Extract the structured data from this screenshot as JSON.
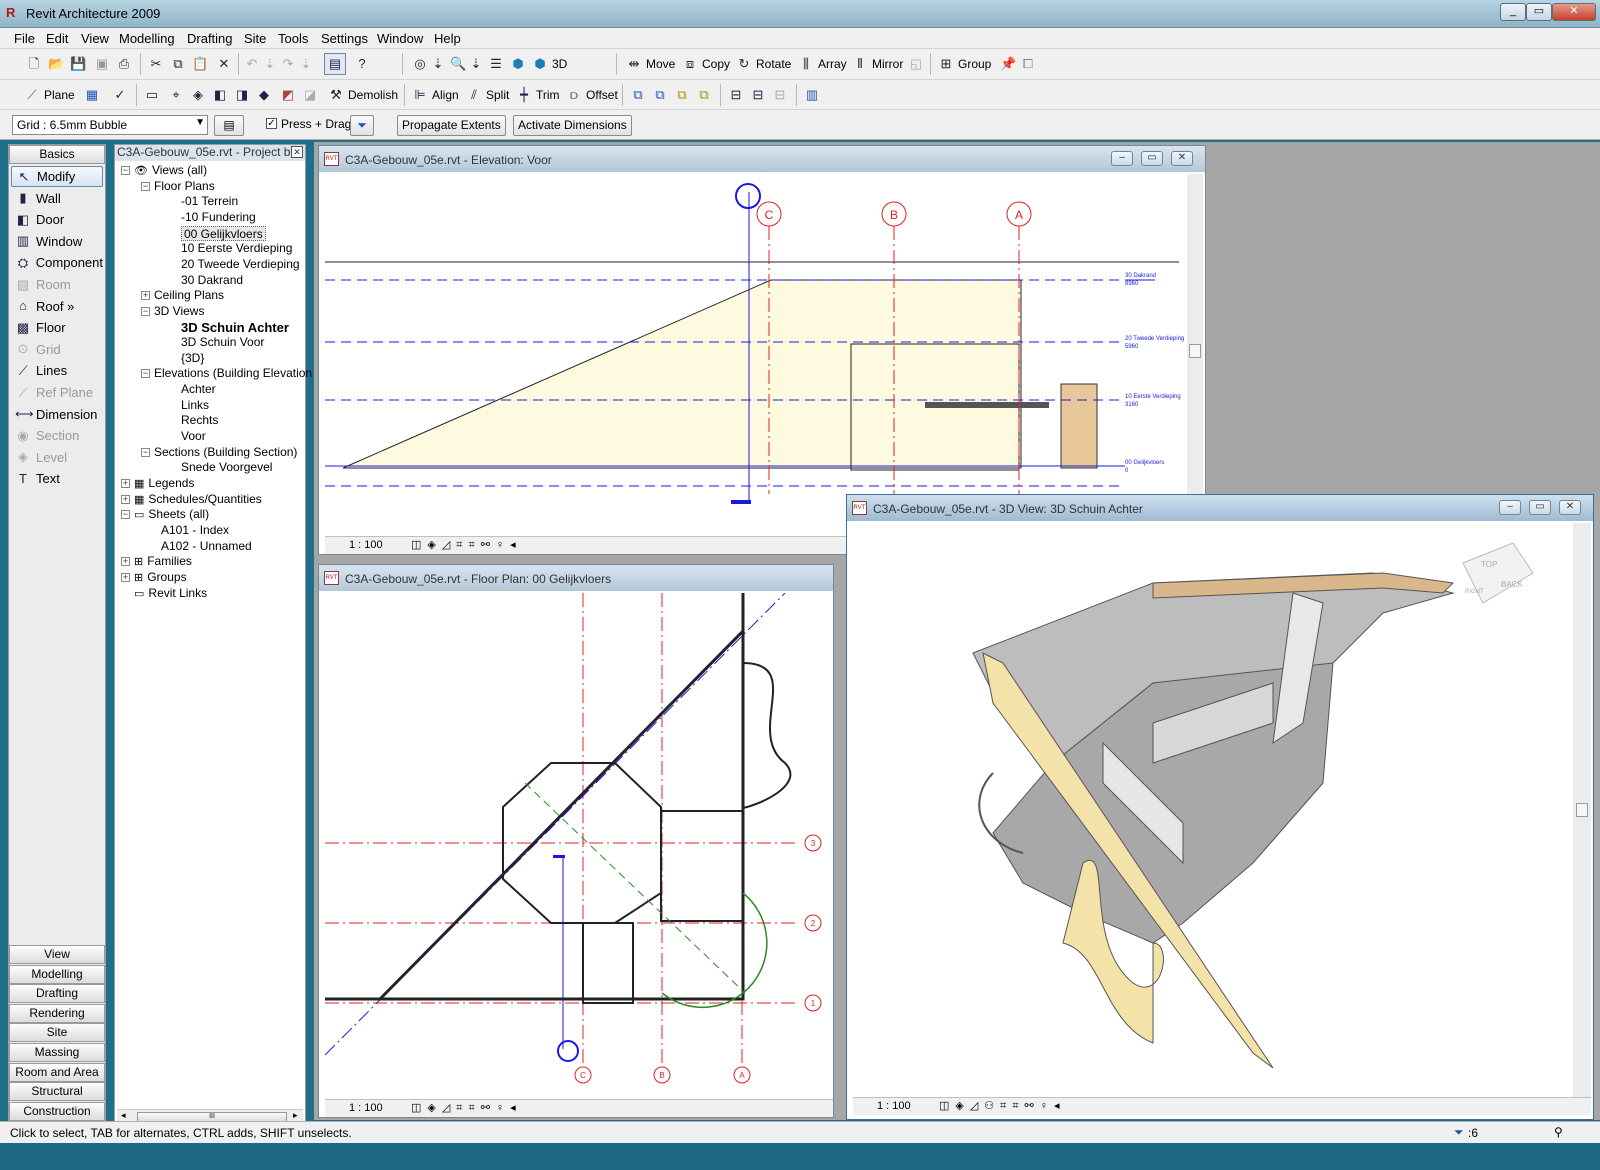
{
  "app": {
    "title": "Revit Architecture 2009"
  },
  "menu": [
    "File",
    "Edit",
    "View",
    "Modelling",
    "Drafting",
    "Site",
    "Tools",
    "Settings",
    "Window",
    "Help"
  ],
  "toolbar1": {
    "view3d": "3D",
    "move": "Move",
    "copy": "Copy",
    "rotate": "Rotate",
    "array": "Array",
    "mirror": "Mirror",
    "group": "Group"
  },
  "toolbar2": {
    "plane": "Plane",
    "demolish": "Demolish",
    "align": "Align",
    "split": "Split",
    "trim": "Trim",
    "offset": "Offset"
  },
  "options": {
    "type_selector": "Grid : 6.5mm Bubble",
    "press_drag": "Press + Drag",
    "propagate": "Propagate Extents",
    "activate_dims": "Activate Dimensions"
  },
  "designbar": {
    "active_tab": "Basics",
    "items": [
      {
        "label": "Modify",
        "icon": "cursor-icon",
        "enabled": true
      },
      {
        "label": "Wall",
        "icon": "wall-icon",
        "enabled": true
      },
      {
        "label": "Door",
        "icon": "door-icon",
        "enabled": true
      },
      {
        "label": "Window",
        "icon": "window-icon",
        "enabled": true
      },
      {
        "label": "Component",
        "icon": "component-icon",
        "enabled": true
      },
      {
        "label": "Room",
        "icon": "room-icon",
        "enabled": false
      },
      {
        "label": "Roof »",
        "icon": "roof-icon",
        "enabled": true
      },
      {
        "label": "Floor",
        "icon": "floor-icon",
        "enabled": true
      },
      {
        "label": "Grid",
        "icon": "grid-icon",
        "enabled": false
      },
      {
        "label": "Lines",
        "icon": "lines-icon",
        "enabled": true
      },
      {
        "label": "Ref Plane",
        "icon": "ref-plane-icon",
        "enabled": false
      },
      {
        "label": "Dimension",
        "icon": "dimension-icon",
        "enabled": true
      },
      {
        "label": "Section",
        "icon": "section-icon",
        "enabled": false
      },
      {
        "label": "Level",
        "icon": "level-icon",
        "enabled": false
      },
      {
        "label": "Text",
        "icon": "text-icon",
        "enabled": true
      }
    ],
    "tabs": [
      "View",
      "Modelling",
      "Drafting",
      "Rendering",
      "Site",
      "Massing",
      "Room and Area",
      "Structural",
      "Construction"
    ]
  },
  "browser": {
    "title": "C3A-Gebouw_05e.rvt - Project b...",
    "root": "Views (all)",
    "floor_plans": "Floor Plans",
    "floor_plan_items": [
      "-01 Terrein",
      "-10 Fundering",
      "00 Gelijkvloers",
      "10 Eerste Verdieping",
      "20 Tweede Verdieping",
      "30 Dakrand"
    ],
    "ceiling_plans": "Ceiling Plans",
    "views3d": "3D Views",
    "views3d_items": [
      "3D Schuin Achter",
      "3D Schuin Voor",
      "{3D}"
    ],
    "elevations": "Elevations (Building Elevation",
    "elevation_items": [
      "Achter",
      "Links",
      "Rechts",
      "Voor"
    ],
    "sections": "Sections (Building Section)",
    "section_items": [
      "Snede Voorgevel"
    ],
    "legends": "Legends",
    "schedules": "Schedules/Quantities",
    "sheets": "Sheets (all)",
    "sheet_items": [
      "A101 - Index",
      "A102 - Unnamed"
    ],
    "families": "Families",
    "groups": "Groups",
    "links": "Revit Links"
  },
  "views": {
    "elevation": {
      "title": "C3A-Gebouw_05e.rvt - Elevation: Voor",
      "scale": "1 : 100",
      "grids": [
        "C",
        "B",
        "A"
      ],
      "levels": [
        {
          "name": "30 Dakrand",
          "elev": "8960"
        },
        {
          "name": "20 Tweede Verdieping",
          "elev": "5960"
        },
        {
          "name": "10 Eerste Verdieping",
          "elev": "3160"
        },
        {
          "name": "00 Gelijkvloers",
          "elev": "0"
        }
      ]
    },
    "floorplan": {
      "title": "C3A-Gebouw_05e.rvt - Floor Plan: 00 Gelijkvloers",
      "scale": "1 : 100",
      "grid_cols": [
        "C",
        "B",
        "A"
      ],
      "grid_rows": [
        "3",
        "2",
        "1"
      ]
    },
    "view3d": {
      "title": "C3A-Gebouw_05e.rvt - 3D View: 3D Schuin Achter",
      "scale": "1 : 100",
      "cube_top": "TOP",
      "cube_back": "BACK",
      "cube_right": "RIGHT"
    }
  },
  "status": {
    "message": "Click to select, TAB for alternates, CTRL adds, SHIFT unselects.",
    "filter_count": ":6"
  },
  "colors": {
    "grid_red": "#e02020",
    "level_blue": "#1a1adc",
    "wall_yellow": "#f4e3a8",
    "floor_gray": "#a8a8a8"
  }
}
